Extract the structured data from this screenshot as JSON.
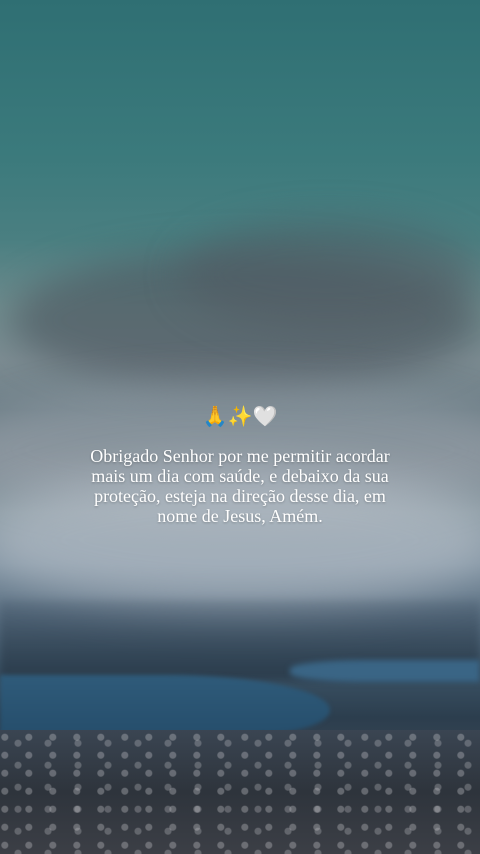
{
  "story": {
    "emojis": "🙏✨🤍",
    "caption": "Obrigado Senhor por me permitir acordar mais um dia com saúde, e debaixo da sua proteção, esteja na direção desse dia, em nome de Jesus, Amém."
  },
  "colors": {
    "sky_top": "#2f6f73",
    "text": "#ffffff"
  }
}
